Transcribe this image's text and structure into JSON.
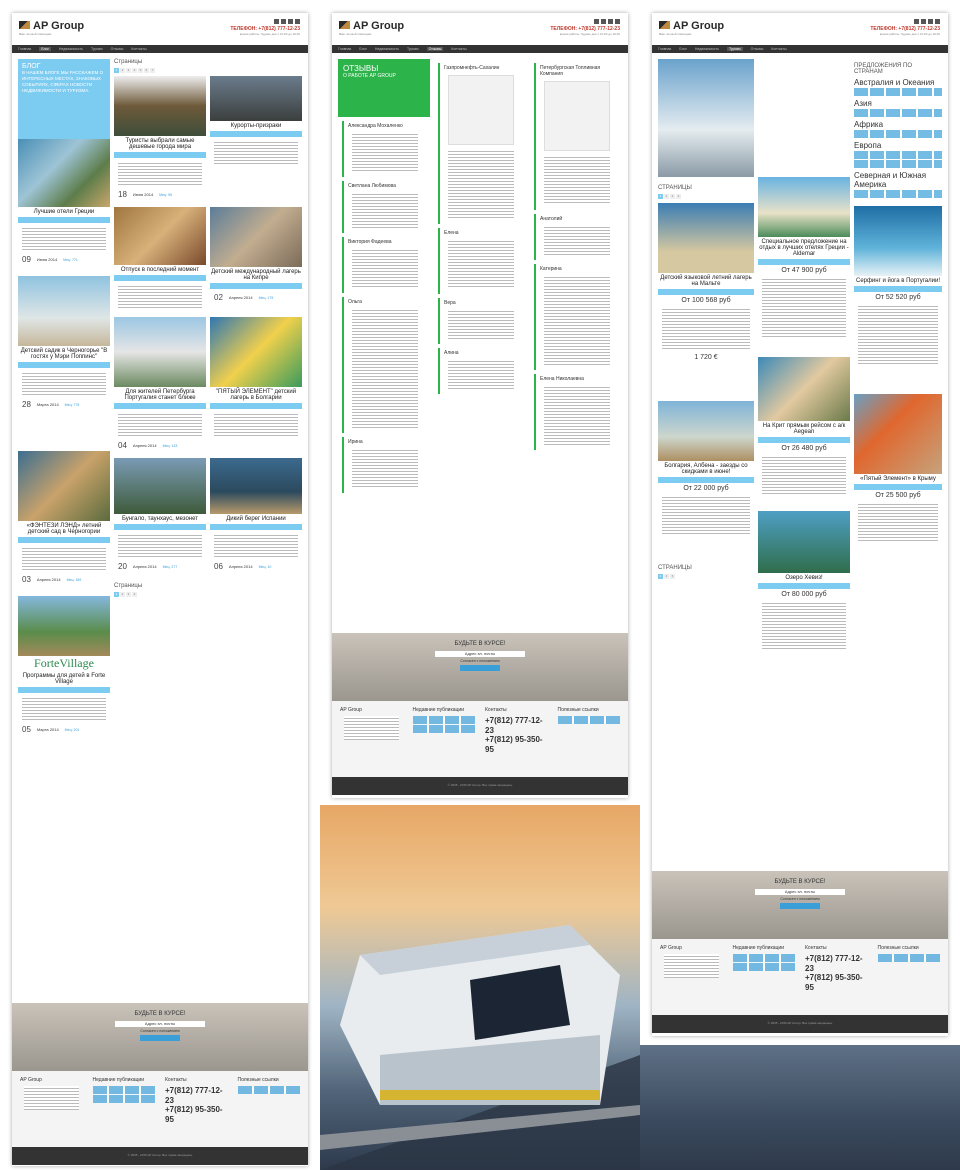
{
  "header": {
    "logo": "AP Group",
    "logo_sub": "Ваш личный помощник",
    "phone": "ТЕЛЕФОН: +7(812) 777-12-23",
    "hours": "время работы: будние дни с 10.00 до 19.00"
  },
  "nav": {
    "items": [
      "Главная",
      "Блог",
      "Недвижимость",
      "Туризм",
      "Отзывы",
      "Контакты"
    ]
  },
  "blog": {
    "title": "БЛОГ",
    "intro": "В НАШЕМ БЛОГЕ МЫ РАССКАЖЕМ О ИНТЕРЕСНЫХ МЕСТАХ, ЗНАКОВЫХ СОБЫТИЯХ, СФЕРАХ НОВОСТИ НЕДВИЖИМОСТИ И ТУРИЗМА.",
    "pages_label": "Страницы",
    "pages": [
      "1",
      "2",
      "3",
      "4",
      "5",
      "6",
      "7"
    ],
    "left": [
      {
        "title": "Лучшие отели Греции",
        "day": "09",
        "month": "Июня 2014",
        "tag": "Мец: 771"
      },
      {
        "title": "Детский садик в Черногорье \"В гостях у Мэри Поппинс\"",
        "day": "28",
        "month": "Марта 2014",
        "tag": "Мец: 775"
      },
      {
        "title": "«ФЭНТЕЗИ ЛЭНД» летний детский сад в Черногории",
        "day": "03",
        "month": "Апреля 2014",
        "tag": "Мец: 189"
      },
      {
        "title": "Программы для детей в Forte Village",
        "day": "05",
        "month": "Марта 2014",
        "tag": "Мец: 201"
      }
    ],
    "right": [
      {
        "title": "Курорты-призраки"
      },
      {
        "title": "Туристы выбрали самые дешевые города мира",
        "day": "18",
        "month": "Июня 2014",
        "tag": "Мец: 95"
      },
      {
        "title": "Детский международный лагерь на Кипре",
        "day": "02",
        "month": "Апреля 2014",
        "tag": "Мец: 175"
      },
      {
        "title": "Отпуск в последний момент"
      },
      {
        "title": "Для жителей Петербурга Португалия станет ближе",
        "day": "04",
        "month": "Апреля 2014",
        "tag": "Мец: 133"
      },
      {
        "title": "\"ПЯТЫЙ ЭЛЕМЕНТ\" детский лагерь в Болгарии"
      },
      {
        "title": "Бунгало, таунхаус, мезонет",
        "day": "20",
        "month": "Апреля 2014",
        "tag": "Мец: 277"
      },
      {
        "title": "Дикий берег Испании",
        "day": "06",
        "month": "Апреля 2014",
        "tag": "Мец: 10"
      }
    ],
    "forte": "ForteVillage"
  },
  "reviews": {
    "title": "ОТЗЫВЫ",
    "subtitle": "О РАБОТЕ AP GROUP",
    "partner": "Газпромнефть-Сахалин",
    "partner2": "Петербургская Топливная Компания",
    "names": [
      "Александра Мохаленко",
      "Светлана Любимова",
      "Виктория Фадеева",
      "Ольга",
      "Ирина",
      "Елена",
      "Анатолий",
      "Катерина",
      "Вера",
      "Алина",
      "Елена Николаевна"
    ]
  },
  "tours": {
    "title": "ПРЕДЛОЖЕНИЯ ПО СТРАНАМ",
    "countries": [
      "Австралия и Океания",
      "Азия",
      "Африка",
      "Европа",
      "Северная и Южная Америка"
    ],
    "pages_label": "СТРАНИЦЫ",
    "items": [
      {
        "title": "Детский языковой летний лагерь на Мальте",
        "price": "От 100 568 руб"
      },
      {
        "title": "Специальное предложение на отдых в лучших отелях Греции - Aldemar",
        "price": "От 47 900 руб"
      },
      {
        "title": "Серфинг и йога в Португалии!",
        "price": "От 52 520 руб"
      },
      {
        "title": "Болгария, Албена - заезды со скидками в июне!",
        "price": "От 22 000 руб"
      },
      {
        "title": "На Крит прямым рейсом с а/к Aegean",
        "price": "От 26 480 руб"
      },
      {
        "title": "«Пятый Элемент» в Крыму",
        "price": "От 25 500 руб"
      },
      {
        "title": "Озеро Хевиз!",
        "price": "От 80 000 руб"
      }
    ],
    "extra_price": "1 720 €"
  },
  "subscribe": {
    "title": "БУДЬТЕ В КУРСЕ!",
    "placeholder": "Адрес эл. почты",
    "agree": "Согласен с положением",
    "button": "Найти"
  },
  "footer": {
    "col1": "AP Group",
    "col2": "Недавние публикации",
    "col3": "Контакты",
    "col4": "Полезные ссылки",
    "phone1": "+7(812) 777-12-23",
    "phone2": "+7(812) 95-350-95",
    "copy": "© 2005 - 2015 AP Group. Все права защищены"
  }
}
